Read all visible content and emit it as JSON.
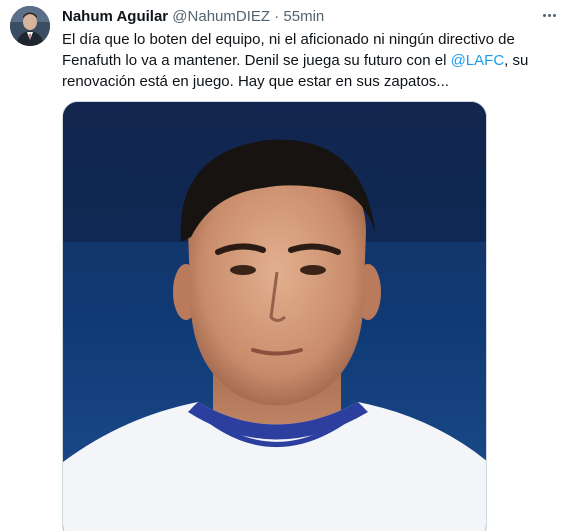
{
  "tweet": {
    "author": {
      "display_name": "Nahum Aguilar",
      "handle": "@NahumDIEZ",
      "separator": "·",
      "time": "55min"
    },
    "text": {
      "part1": "El día que lo boten del equipo, ni el aficionado ni ningún directivo de Fenafuth lo va a mantener. Denil se juega su futuro con el ",
      "mention": "@LAFC",
      "part2": ", su renovación está en juego. Hay que estar en sus zapatos..."
    },
    "icons": {
      "more": "more-options-icon"
    },
    "colors": {
      "text": "#0f1419",
      "secondary": "#536471",
      "link": "#1d9bf0",
      "border": "#cfd9de"
    }
  }
}
